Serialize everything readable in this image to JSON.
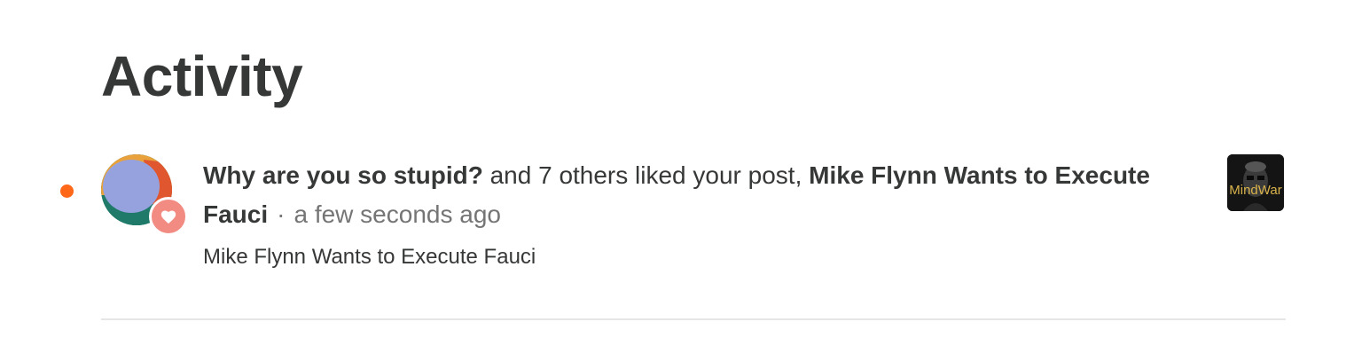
{
  "page": {
    "title": "Activity"
  },
  "activity_item": {
    "liker_name": "Why are you so stupid?",
    "action_text": " and 7 others liked your post, ",
    "post_title": "Mike Flynn Wants to Execute Fauci",
    "separator": "·",
    "time_ago": "a few seconds ago",
    "subtitle": "Mike Flynn Wants to Execute Fauci",
    "unread": true,
    "avatar_icon": "user-avatar-icon",
    "badge_icon": "heart-icon",
    "thumbnail_logo_text": "MindWar"
  },
  "colors": {
    "unread_dot": "#ff6719",
    "like_badge": "#f28b82",
    "text_primary": "#363737",
    "text_secondary": "#757575",
    "divider": "#e6e6e6"
  }
}
